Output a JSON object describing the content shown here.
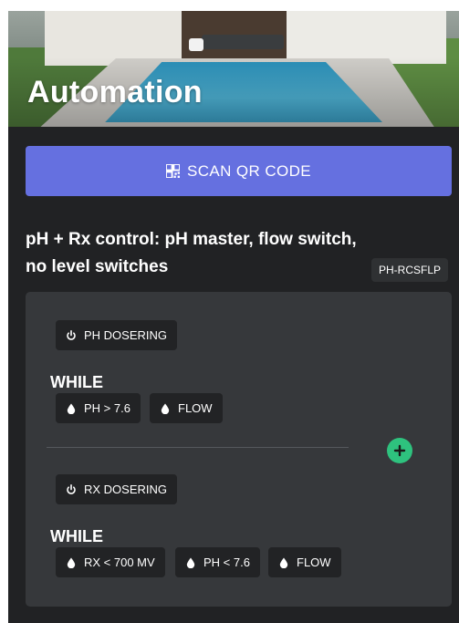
{
  "hero": {
    "title": "Automation"
  },
  "scan_button": {
    "label": "SCAN QR CODE",
    "icon": "qr-code-icon",
    "color": "#6570e0"
  },
  "config": {
    "title": "pH + Rx control: pH master, flow switch, no level switches",
    "code": "PH-RCSFLP"
  },
  "rules": [
    {
      "action": {
        "icon": "power-icon",
        "label": "PH DOSERING"
      },
      "while_label": "WHILE",
      "conditions": [
        {
          "icon": "drop-icon",
          "label": "PH > 7.6"
        },
        {
          "icon": "drop-icon",
          "label": "FLOW"
        }
      ]
    },
    {
      "action": {
        "icon": "power-icon",
        "label": "RX DOSERING"
      },
      "while_label": "WHILE",
      "conditions": [
        {
          "icon": "drop-icon",
          "label": "RX < 700 MV"
        },
        {
          "icon": "drop-icon",
          "label": "PH < 7.6"
        },
        {
          "icon": "drop-icon",
          "label": "FLOW"
        }
      ]
    }
  ],
  "add_button": {
    "icon": "plus-icon",
    "color": "#2ec27e"
  },
  "colors": {
    "background": "#212224",
    "panel": "#36383b",
    "chip": "#222325"
  }
}
